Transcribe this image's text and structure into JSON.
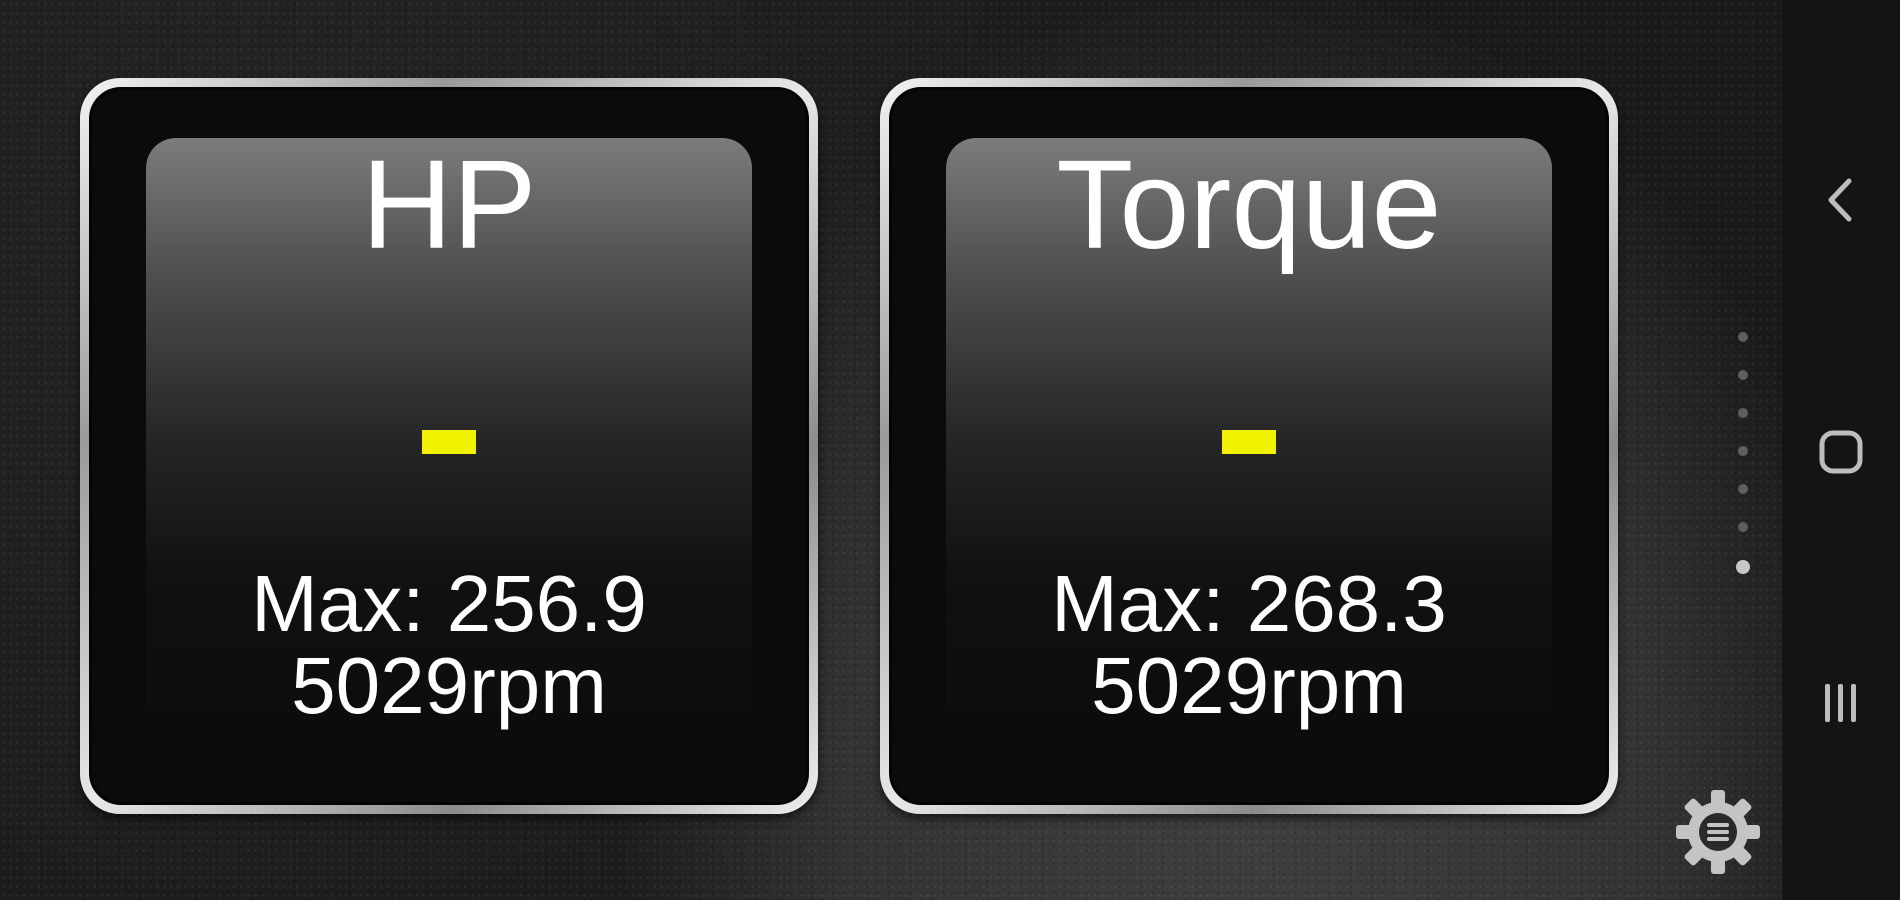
{
  "gauges": [
    {
      "title": "HP",
      "value": "-",
      "max_line": "Max: 256.9",
      "rpm_line": "5029rpm"
    },
    {
      "title": "Torque",
      "value": "-",
      "max_line": "Max: 268.3",
      "rpm_line": "5029rpm"
    }
  ],
  "page_indicator": {
    "total_pages": 7,
    "active_page": 7
  },
  "settings": {
    "icon": "gear-menu-icon"
  },
  "navbar": {
    "back_icon": "back-chevron-icon",
    "home_icon": "home-icon",
    "recents_icon": "recents-icon"
  },
  "colors": {
    "value_indicator": "#f2f200",
    "bezel": "#e0e0e0",
    "gauge_background": "#0b0b0b"
  }
}
